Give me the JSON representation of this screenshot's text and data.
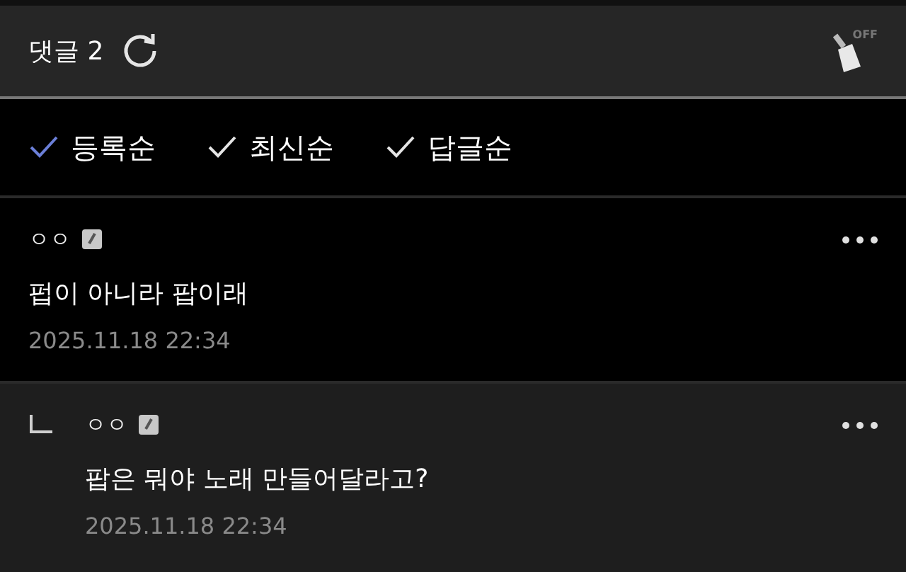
{
  "header": {
    "title": "댓글 2",
    "toggle_label": "OFF"
  },
  "sort_options": [
    {
      "label": "등록순",
      "selected": true
    },
    {
      "label": "최신순",
      "selected": false
    },
    {
      "label": "답글순",
      "selected": false
    }
  ],
  "comments": [
    {
      "kind": "comment",
      "author": "ㅇㅇ",
      "text": "펍이 아니라 팝이래",
      "date": "2025.11.18 22:34"
    },
    {
      "kind": "reply",
      "author": "ㅇㅇ",
      "text": "팝은 뭐야 노래 만들어달라고?",
      "date": "2025.11.18 22:34"
    }
  ]
}
